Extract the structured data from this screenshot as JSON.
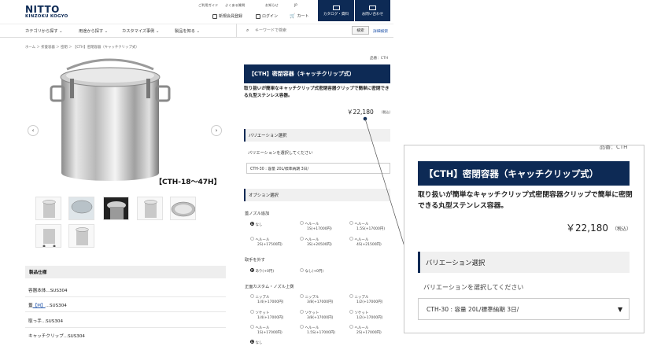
{
  "header": {
    "logo_main": "NITTO",
    "logo_sub": "KINZOKU KOGYO",
    "top_links": [
      "ご利用ガイド",
      "よくある質問",
      "お知らせ",
      "JP"
    ],
    "user_links": [
      "新規会員登録",
      "ログイン",
      "カート"
    ],
    "catalog_button": "カタログ・資料",
    "contact_button": "お問い合わせ"
  },
  "nav": {
    "items": [
      "カテゴリから探す",
      "用途から探す",
      "カスタマイズ事例",
      "製品を知る"
    ],
    "search_placeholder": "キーワードで検索",
    "search_button": "検索",
    "advanced_search": "詳細検索"
  },
  "breadcrumb": "ホーム ＞ 折畳容器 ＞ 密閉 ＞ 【CTH】密閉容器（キャッチクリップ式）",
  "gallery": {
    "caption": "【CTH-18～47H】",
    "prev": "‹",
    "next": "›"
  },
  "specs": {
    "heading": "製品仕様",
    "rows": [
      {
        "label": "容器本体...",
        "value": "SUS304"
      },
      {
        "label": "蓋",
        "link": "【M】",
        "value": "...SUS304"
      },
      {
        "label": "取っ手...",
        "value": "SUS304"
      },
      {
        "label": "キャッチクリップ...",
        "value": "SUS304"
      }
    ]
  },
  "product": {
    "number_label": "品番：CTH",
    "title": "【CTH】密閉容器（キャッチクリップ式）",
    "description": "取り扱いが簡単なキャッチクリップ式密閉容器クリップで簡単に密閉できる丸型ステンレス容器。",
    "price": "￥22,180",
    "tax_note": "（税込）"
  },
  "variation": {
    "heading": "バリエーション選択",
    "hint": "バリエーションを選択してください",
    "selected": "CTH-30 : 容量 20L/標準納期 3日/"
  },
  "options": {
    "heading": "オプション選択",
    "group1_label": "蓋ノズル追加",
    "group1": [
      [
        "なし",
        ""
      ],
      [
        "ヘルール",
        "1S(+17000円)"
      ],
      [
        "ヘルール",
        "1.5S(+17000円)"
      ],
      [
        "ヘルール",
        "2S(+17500円)"
      ],
      [
        "ヘルール",
        "3S(+20500円)"
      ],
      [
        "ヘルール",
        "4S(+21500円)"
      ]
    ],
    "group2_label": "取手を外す",
    "group2": [
      [
        "あり(+0円)",
        ""
      ],
      [
        "なし(+0円)",
        ""
      ]
    ],
    "group3_label": "正面カスタム・ノズル上側",
    "group3": [
      [
        "ニップル",
        "1/4(+17000円)"
      ],
      [
        "ニップル",
        "3/8(+17000円)"
      ],
      [
        "ニップル",
        "1/2(+17000円)"
      ],
      [
        "ソケット",
        "1/4(+17000円)"
      ],
      [
        "ソケット",
        "3/8(+17000円)"
      ],
      [
        "ソケット",
        "1/2(+17000円)"
      ],
      [
        "ヘルール",
        "1S(+17000円)"
      ],
      [
        "ヘルール",
        "1.5S(+17000円)"
      ],
      [
        "ヘルール",
        "2S(+17000円)"
      ],
      [
        "なし",
        ""
      ]
    ]
  },
  "zoom": {
    "cut_label": "品番：CTH"
  },
  "colors": {
    "navy": "#0d2a55",
    "link": "#2255aa"
  }
}
